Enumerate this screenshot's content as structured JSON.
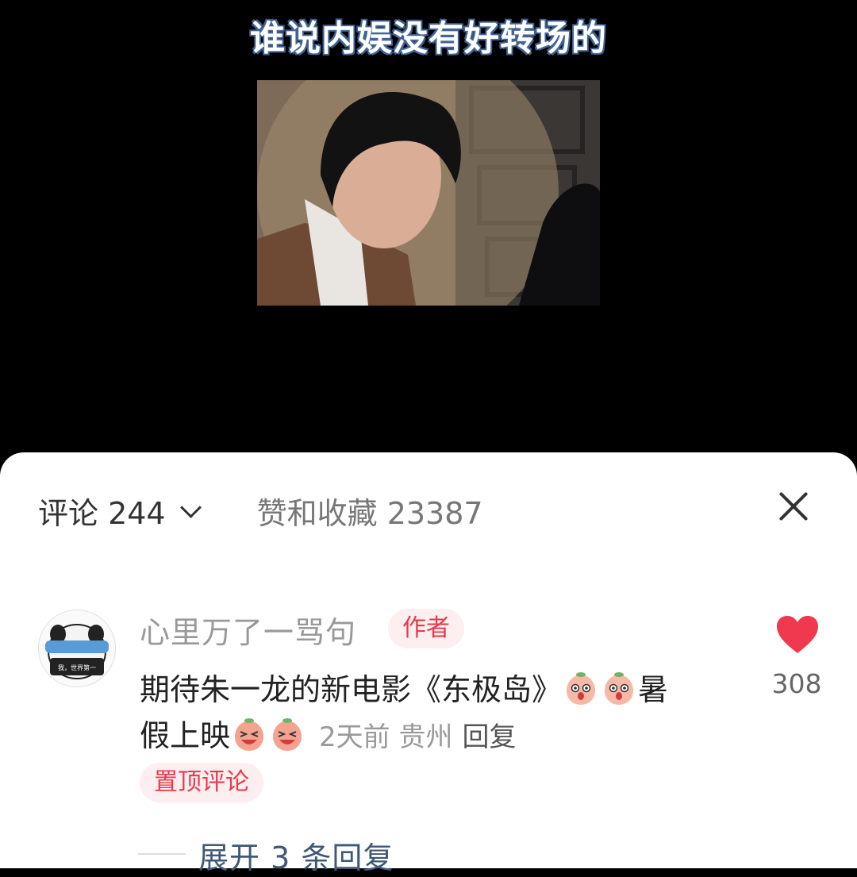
{
  "video": {
    "caption": "谁说内娱没有好转场的"
  },
  "panel": {
    "comments_label": "评论 244",
    "likes_label": "赞和收藏 23387"
  },
  "comment": {
    "username": "心里万了一骂句",
    "author_badge": "作者",
    "text_part1": "期待朱一龙的新电影《东极岛》",
    "text_part2": "暑假上映",
    "time": "2天前",
    "location": "贵州",
    "reply_label": "回复",
    "pinned_label": "置顶评论",
    "like_count": "308",
    "expand_label": "展开 3 条回复",
    "avatar_text": "我，世界第一"
  },
  "colors": {
    "accent": "#e8394d",
    "badge_bg": "#fdeef0",
    "expand": "#3f5877"
  },
  "icons": [
    "chevron-down-icon",
    "close-icon",
    "heart-icon",
    "peach-emoji-icon",
    "laugh-emoji-icon"
  ]
}
